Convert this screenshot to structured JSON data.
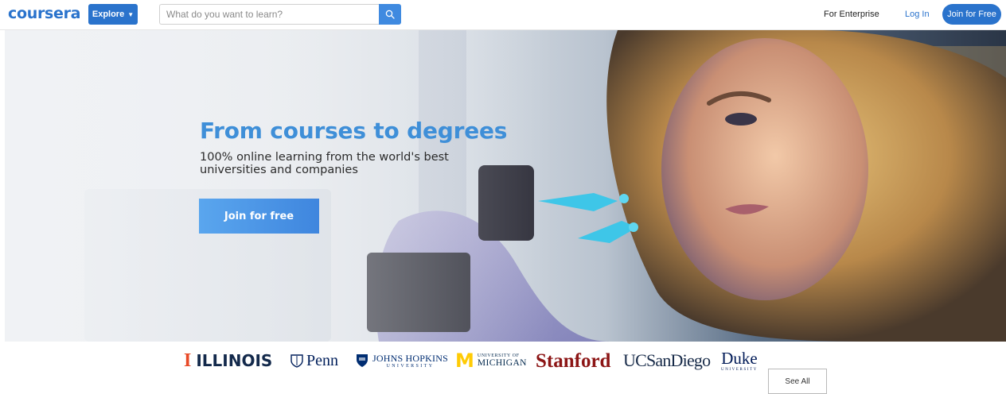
{
  "header": {
    "logo_text": "coursera",
    "explore_label": "Explore",
    "search_placeholder": "What do you want to learn?",
    "search_value": "",
    "enterprise_label": "For Enterprise",
    "login_label": "Log In",
    "join_label": "Join for Free"
  },
  "hero": {
    "title": "From courses to degrees",
    "subtitle": "100% online learning from the world's best universities and companies",
    "cta_label": "Join for free"
  },
  "partners": {
    "illinois": "ILLINOIS",
    "penn": "Penn",
    "jhu_line1": "JOHNS HOPKINS",
    "jhu_line2": "UNIVERSITY",
    "michigan_line1": "UNIVERSITY OF",
    "michigan_line2": "MICHIGAN",
    "stanford": "Stanford",
    "ucsd": "UCSanDiego",
    "duke_line1": "Duke",
    "duke_line2": "UNIVERSITY",
    "see_all_label": "See All"
  },
  "colors": {
    "brand_blue": "#2a73cc",
    "hero_title_blue": "#3f8fd8",
    "illinois_orange": "#e84a27",
    "michigan_maize": "#ffcb05",
    "stanford_cardinal": "#8c1515"
  },
  "icons": {
    "search": "search-icon",
    "explore_chevron": "chevron-down-icon",
    "illinois_mark": "illinois-block-i-icon",
    "penn_mark": "penn-shield-icon",
    "jhu_mark": "jhu-shield-icon",
    "michigan_mark": "michigan-block-m-icon"
  }
}
